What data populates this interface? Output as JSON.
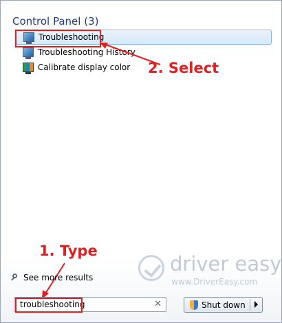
{
  "results": {
    "section_title": "Control Panel (3)",
    "items": [
      {
        "label": "Troubleshooting",
        "icon": "troubleshooting-icon",
        "selected": true
      },
      {
        "label": "Troubleshooting History",
        "icon": "troubleshooting-history-icon",
        "selected": false
      },
      {
        "label": "Calibrate display color",
        "icon": "calibrate-display-icon",
        "selected": false
      }
    ]
  },
  "see_more": {
    "label": "See more results",
    "icon": "magnifier-icon"
  },
  "search": {
    "value": "troubleshooting",
    "clear_icon": "✕"
  },
  "shutdown": {
    "label": "Shut down",
    "icon": "uac-shield-icon"
  },
  "annotations": {
    "step1": "1. Type",
    "step2": "2. Select",
    "color": "#e02020"
  },
  "watermark": {
    "title": "driver easy",
    "url": "www.DriverEasy.com"
  }
}
